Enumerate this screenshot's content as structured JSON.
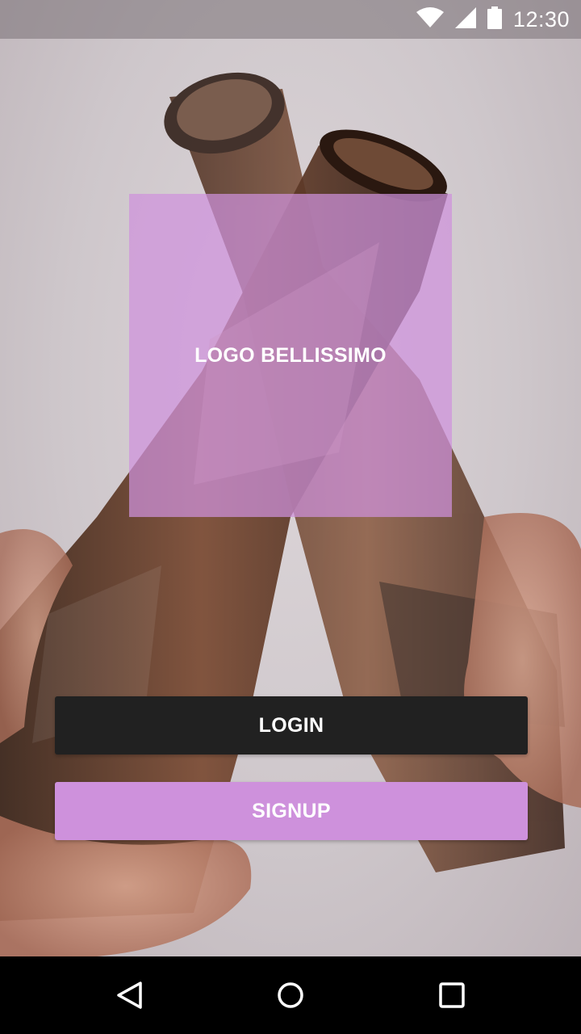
{
  "status_bar": {
    "time": "12:30",
    "icons": [
      "wifi-icon",
      "cell-signal-icon",
      "battery-icon"
    ]
  },
  "logo": {
    "text": "LOGO BELLISSIMO"
  },
  "buttons": {
    "login_label": "LOGIN",
    "signup_label": "SIGNUP"
  },
  "nav_bar": {
    "icons": [
      "back-icon",
      "home-icon",
      "recents-icon"
    ]
  },
  "colors": {
    "accent": "#ce91dc",
    "login_button": "#212121",
    "nav_bar": "#000000"
  }
}
